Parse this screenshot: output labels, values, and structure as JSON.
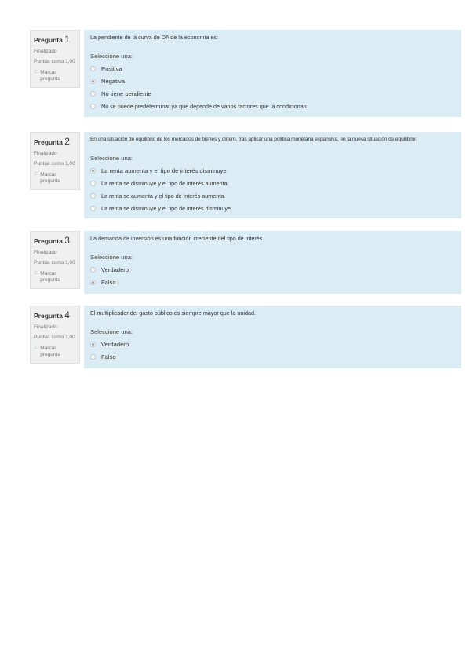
{
  "questions": [
    {
      "label": "Pregunta",
      "number": "1",
      "state": "Finalizado",
      "grade": "Puntúa como 1,00",
      "flag_text": "Marcar pregunta",
      "text": "La pendiente de la curva de DA de la economía es:",
      "prompt": "Seleccione una:",
      "options": [
        {
          "label": "Positiva",
          "checked": false
        },
        {
          "label": "Negativa",
          "checked": true
        },
        {
          "label": "No tiene pendiente",
          "checked": false
        },
        {
          "label": "No se puede predeterminar ya que depende de varios factores que la condicionan",
          "checked": false
        }
      ]
    },
    {
      "label": "Pregunta",
      "number": "2",
      "state": "Finalizado",
      "grade": "Puntúa como 1,00",
      "flag_text": "Marcar pregunta",
      "text": "En una situación de equilibrio de los mercados de bienes y dinero, tras aplicar una política monetaria expansiva, en la nueva situación de equilibrio:",
      "prompt": "Seleccione una:",
      "options": [
        {
          "label": "La renta aumenta y el tipo de interés disminuye",
          "checked": true
        },
        {
          "label": "La renta se disminuye y el tipo de interés aumenta",
          "checked": false
        },
        {
          "label": "La renta se aumenta y el tipo de interés aumenta.",
          "checked": false
        },
        {
          "label": "La renta se disminuye y el tipo de interés disminuye",
          "checked": false
        }
      ]
    },
    {
      "label": "Pregunta",
      "number": "3",
      "state": "Finalizado",
      "grade": "Puntúa como 1,00",
      "flag_text": "Marcar pregunta",
      "text": "La demanda de inversión es una función creciente del tipo de interés.",
      "prompt": "Seleccione una:",
      "options": [
        {
          "label": "Verdadero",
          "checked": false
        },
        {
          "label": "Falso",
          "checked": true
        }
      ]
    },
    {
      "label": "Pregunta",
      "number": "4",
      "state": "Finalizado",
      "grade": "Puntúa como 1,00",
      "flag_text": "Marcar pregunta",
      "text": "El multiplicador del gasto público es siempre mayor que la unidad.",
      "prompt": "Seleccione una:",
      "options": [
        {
          "label": "Verdadero",
          "checked": true
        },
        {
          "label": "Falso",
          "checked": false
        }
      ]
    }
  ]
}
